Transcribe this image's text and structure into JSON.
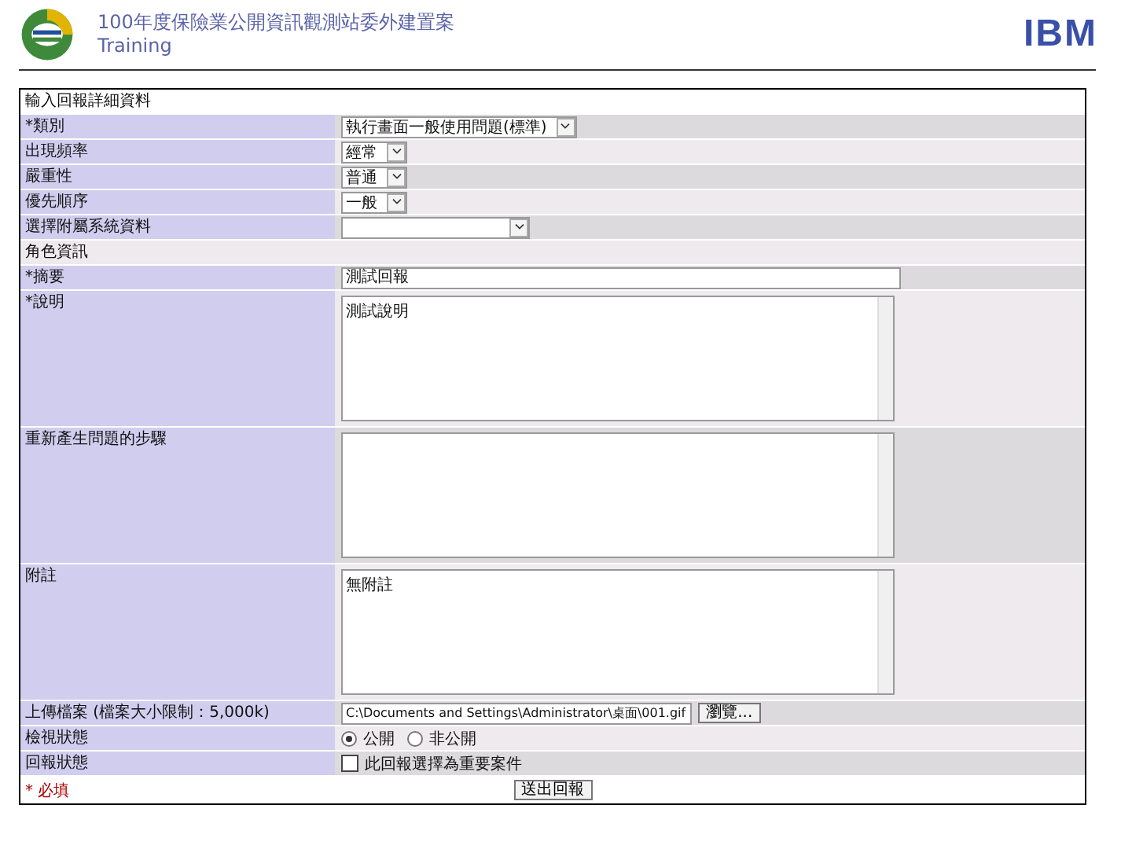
{
  "header": {
    "title": "100年度保險業公開資訊觀測站委外建置案",
    "subtitle": "Training",
    "brand": "IBM"
  },
  "form": {
    "title": "輸入回報詳細資料",
    "rows": [
      {
        "kind": "select",
        "label": "*類別",
        "value": "執行畫面一般使用問題(標準)"
      },
      {
        "kind": "select",
        "label": "出現頻率",
        "value": "經常"
      },
      {
        "kind": "select",
        "label": "嚴重性",
        "value": "普通"
      },
      {
        "kind": "select",
        "label": "優先順序",
        "value": "一般"
      },
      {
        "kind": "select",
        "label": "選擇附屬系統資料",
        "value": ""
      },
      {
        "kind": "section",
        "label": "角色資訊"
      },
      {
        "kind": "text",
        "label": "*摘要",
        "value": "測試回報"
      },
      {
        "kind": "textarea",
        "label": "*說明",
        "value": "測試說明"
      },
      {
        "kind": "textarea",
        "label": "重新產生問題的步驟",
        "value": ""
      },
      {
        "kind": "textarea",
        "label": "附註",
        "value": "無附註"
      },
      {
        "kind": "file",
        "label": "上傳檔案 (檔案大小限制：5,000k)",
        "value": "C:\\Documents and Settings\\Administrator\\桌面\\001.gif",
        "button": "瀏覽..."
      },
      {
        "kind": "radio",
        "label": "檢視狀態",
        "options": [
          {
            "label": "公開",
            "selected": true
          },
          {
            "label": "非公開",
            "selected": false
          }
        ]
      },
      {
        "kind": "checkbox",
        "label": "回報狀態",
        "text": "此回報選擇為重要案件",
        "checked": false
      }
    ],
    "note": "* 必填",
    "submit": "送出回報"
  }
}
